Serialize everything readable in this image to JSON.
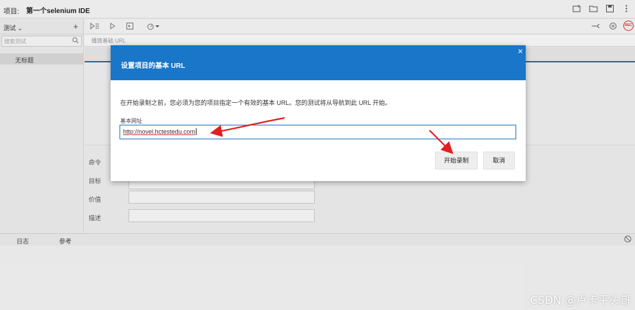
{
  "titlebar": {
    "project_label": "项目:",
    "project_name": "第一个selenium IDE",
    "icons": [
      "new-folder-icon",
      "open-folder-icon",
      "save-icon",
      "more-vert-icon"
    ]
  },
  "left_panel": {
    "header_label": "测试 ⌄",
    "add_symbol": "+",
    "search_placeholder": "搜索测试",
    "tests": [
      "无标题"
    ]
  },
  "toolbar": {
    "record_label": "REC"
  },
  "url_bar": {
    "placeholder": "播放基础 URL"
  },
  "command_panel": {
    "command_label": "命令",
    "target_label": "目标",
    "value_label": "价值",
    "description_label": "描述"
  },
  "log_bar": {
    "tabs": [
      "日志",
      "参考"
    ]
  },
  "modal": {
    "title": "设置项目的基本 URL",
    "close_symbol": "×",
    "description": "在开始录制之前，您必须为您的项目指定一个有效的基本 URL。您的测试将从导航到此 URL 开始。",
    "field_label": "基本网址",
    "field_value": "http://novel.hctestedu.com",
    "start_button": "开始录制",
    "cancel_button": "取消"
  },
  "annotation": {
    "arrow_color": "#e02020"
  },
  "watermark": "CSDN @卢卡平头哥"
}
